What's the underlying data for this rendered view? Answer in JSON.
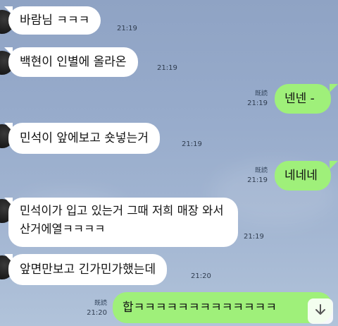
{
  "messages": [
    {
      "dir": "in",
      "text": "바람님 ㅋㅋㅋ",
      "time": "21:19"
    },
    {
      "dir": "in",
      "text": "백현이 인별에 올라온",
      "time": "21:19"
    },
    {
      "dir": "out",
      "text": "넨넨 -",
      "time": "21:19",
      "read": "既読"
    },
    {
      "dir": "in",
      "text": "민석이 앞에보고 숏넣는거",
      "time": "21:19"
    },
    {
      "dir": "out",
      "text": "네네네",
      "time": "21:19",
      "read": "既読"
    },
    {
      "dir": "in",
      "text": "민석이가 입고 있는거 그때 저희 매장 와서 산거에열ㅋㅋㅋㅋ",
      "time": "21:19"
    },
    {
      "dir": "in",
      "text": "앞면만보고 긴가민가했는데",
      "time": "21:20"
    },
    {
      "dir": "out",
      "text": "합ㅋㅋㅋㅋㅋㅋㅋㅋㅋㅋㅋㅋㅋ",
      "time": "21:20",
      "read": "既読"
    }
  ],
  "colors": {
    "incoming_bubble": "#ffffff",
    "outgoing_bubble": "#9ff07a",
    "background": "#97abcb"
  },
  "icons": {
    "scroll_down": "arrow-down-icon"
  }
}
